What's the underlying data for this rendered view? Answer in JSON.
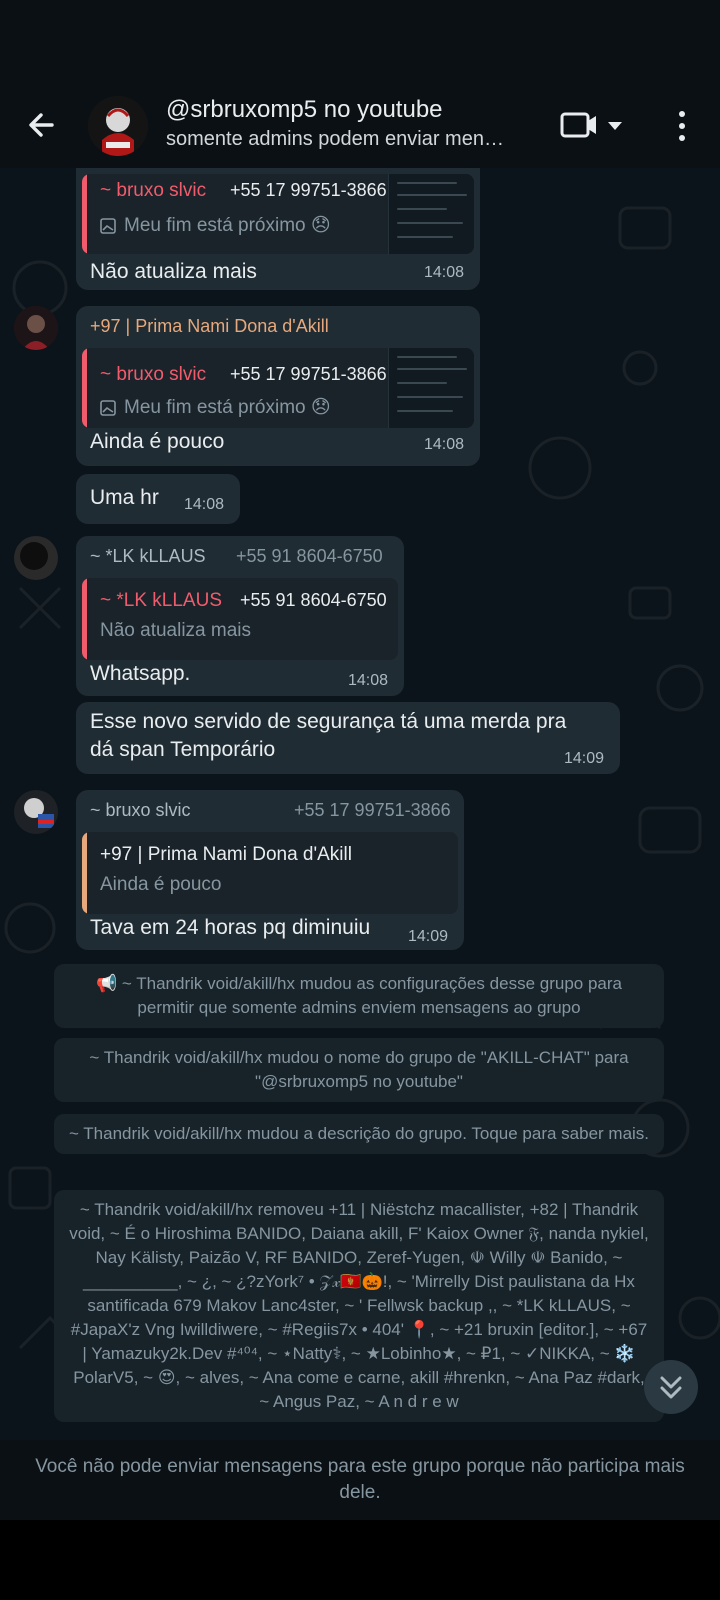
{
  "header": {
    "title": "@srbruxomp5 no youtube",
    "subtitle": "somente admins podem enviar men…"
  },
  "messages": [
    {
      "quote_name": "~ bruxo slvic",
      "quote_phone": "+55 17 99751-3866",
      "quote_text": "Meu fim está próximo 😞",
      "text": "Não atualiza mais",
      "time": "14:08"
    },
    {
      "sender": "+97 | Prima Nami Dona d'Akill",
      "quote_name": "~ bruxo slvic",
      "quote_phone": "+55 17 99751-3866",
      "quote_text": "Meu fim está próximo 😞",
      "text": "Ainda é pouco",
      "time": "14:08"
    },
    {
      "text": "Uma hr",
      "time": "14:08"
    },
    {
      "sender": "~ *LK kLLAUS",
      "phone": "+55 91 8604-6750",
      "quote_name": "~ *LK kLLAUS",
      "quote_phone": "+55 91 8604-6750",
      "quote_text": "Não atualiza mais",
      "text": "Whatsapp.",
      "time": "14:08"
    },
    {
      "text_line1": "Esse novo servido de segurança tá uma merda pra",
      "text_line2": "dá span Temporário",
      "time": "14:09"
    },
    {
      "sender": "~ bruxo slvic",
      "phone": "+55 17 99751-3866",
      "quote_name": "+97 | Prima Nami Dona d'Akill",
      "quote_text": "Ainda é pouco",
      "text": "Tava em 24 horas pq diminuiu",
      "time": "14:09"
    }
  ],
  "system_messages": [
    "📢 ~ Thandrik void/akill/hx mudou as configurações desse grupo para permitir que somente admins enviem mensagens ao grupo",
    "~ Thandrik void/akill/hx mudou o nome do grupo de \"AKILL-CHAT\" para \"@srbruxomp5 no youtube\"",
    "~ Thandrik void/akill/hx mudou a descrição do grupo. Toque para saber mais.",
    "~ Thandrik void/akill/hx removeu +11 | Niëstchz macallister, +82 | Thandrik void, ~ É o Hiroshima BANIDO, Daiana akill, F' Kaiox Owner 𝔉, nanda nykiel, Nay Kälisty, Paizão V, RF BANIDO, Zeref-Yugen, ☫ Willy ☫ Banido, ~ __________, ~ ¿, ~ ¿?zYork⁷ • 𝒵𝓍🇲🇪🎃!, ~ 'Mirrelly Dist paulistana da Hx santificada 679 Makov Lanc4ster, ~ ' Fellwsk backup ,, ~ *LK kLLAUS, ~ #JapaX'z Vng Iwilldiwere, ~ #Regiis7x • 404' 📍, ~ +21 bruxin [editor.], ~ +67 | Yamazuky2k.Dev #⁴⁰⁴, ~ ⋆Natty⚕, ~ ★Lobinho★, ~ ₽1, ~ ✓NIKKA, ~ ❄️ PolarV5, ~ 😍, ~ alves, ~ Ana come e carne, akill #hrenkn, ~ Ana Paz #dark, ~ Angus Paz, ~ A n d r e w"
  ],
  "footer": {
    "text": "Você não pode enviar mensagens para este grupo porque não participa mais dele."
  },
  "colors": {
    "bubble": "#202c33",
    "quote_red": "#f15c6d",
    "quote_orange": "#e6a87c",
    "sender_orange": "#e6a87c"
  }
}
